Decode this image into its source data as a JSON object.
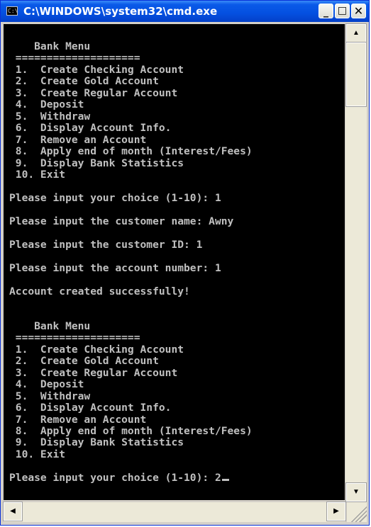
{
  "window": {
    "title": "C:\\WINDOWS\\system32\\cmd.exe",
    "icon": "cmd-console-icon",
    "icon_text": "C:\\",
    "buttons": {
      "minimize": "_",
      "maximize": "□",
      "close": "✕"
    }
  },
  "console": {
    "text": "    Bank Menu\n ====================\n 1.  Create Checking Account\n 2.  Create Gold Account\n 3.  Create Regular Account\n 4.  Deposit\n 5.  Withdraw\n 6.  Display Account Info.\n 7.  Remove an Account\n 8.  Apply end of month (Interest/Fees)\n 9.  Display Bank Statistics\n 10. Exit\n\nPlease input your choice (1-10): 1\n\nPlease input the customer name: Awny\n\nPlease input the customer ID: 1\n\nPlease input the account number: 1\n\nAccount created successfully!\n\n\n    Bank Menu\n ====================\n 1.  Create Checking Account\n 2.  Create Gold Account\n 3.  Create Regular Account\n 4.  Deposit\n 5.  Withdraw\n 6.  Display Account Info.\n 7.  Remove an Account\n 8.  Apply end of month (Interest/Fees)\n 9.  Display Bank Statistics\n 10. Exit\n\nPlease input your choice (1-10): 2",
    "colors": {
      "background": "#000000",
      "foreground": "#c0c0c0"
    }
  },
  "scrollbars": {
    "up_arrow": "▲",
    "down_arrow": "▼",
    "left_arrow": "◀",
    "right_arrow": "▶"
  },
  "colors": {
    "titlebar": "#0a5ae8",
    "chrome": "#ece9d8"
  }
}
